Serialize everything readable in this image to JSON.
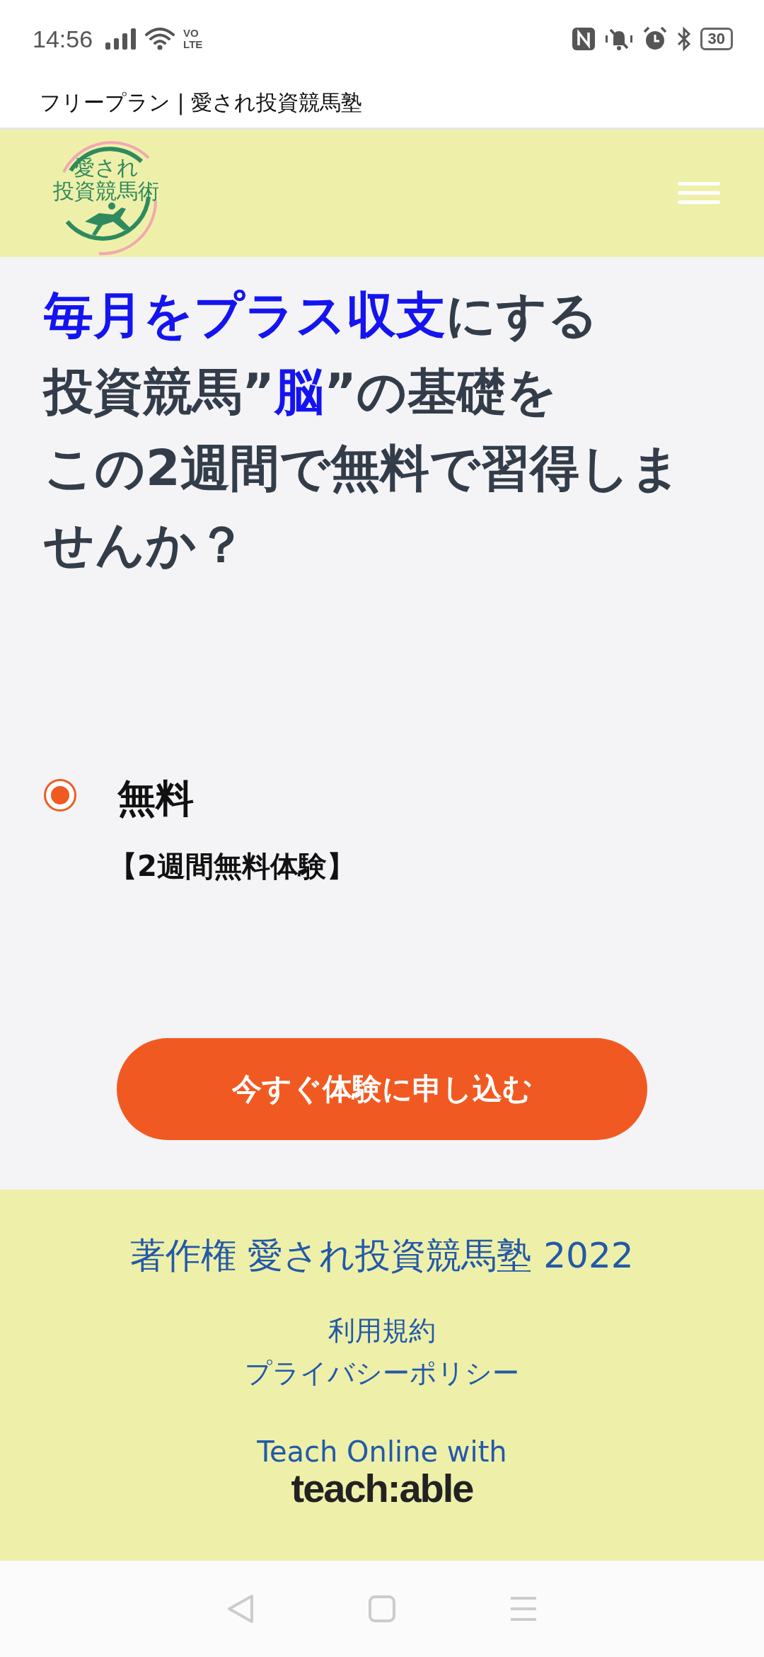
{
  "status_bar": {
    "time": "14:56",
    "network_label_top": "VO",
    "network_label_bottom": "LTE",
    "battery": "30"
  },
  "page_title": "フリープラン | 愛され投資競馬塾",
  "header": {
    "logo_text_top": "愛され",
    "logo_text_bottom": "投資競馬術"
  },
  "headline": [
    [
      {
        "text": "毎月をプラス収支",
        "highlight": true
      },
      {
        "text": "にする",
        "highlight": false
      }
    ],
    [
      {
        "text": "投資競馬”",
        "highlight": false
      },
      {
        "text": "脳",
        "highlight": true
      },
      {
        "text": "”の基礎を",
        "highlight": false
      }
    ],
    [
      {
        "text": "この2週間で無料で習得しませんか？",
        "highlight": false
      }
    ]
  ],
  "plans": [
    {
      "name": "無料",
      "description": "【2週間無料体験】",
      "selected": true
    }
  ],
  "cta_button": "今すぐ体験に申し込む",
  "footer": {
    "copyright": "著作権 愛され投資競馬塾 2022",
    "links": [
      "利用規約",
      "プライバシーポリシー"
    ],
    "powered_by": "Teach Online with",
    "brand": "teach:able"
  }
}
